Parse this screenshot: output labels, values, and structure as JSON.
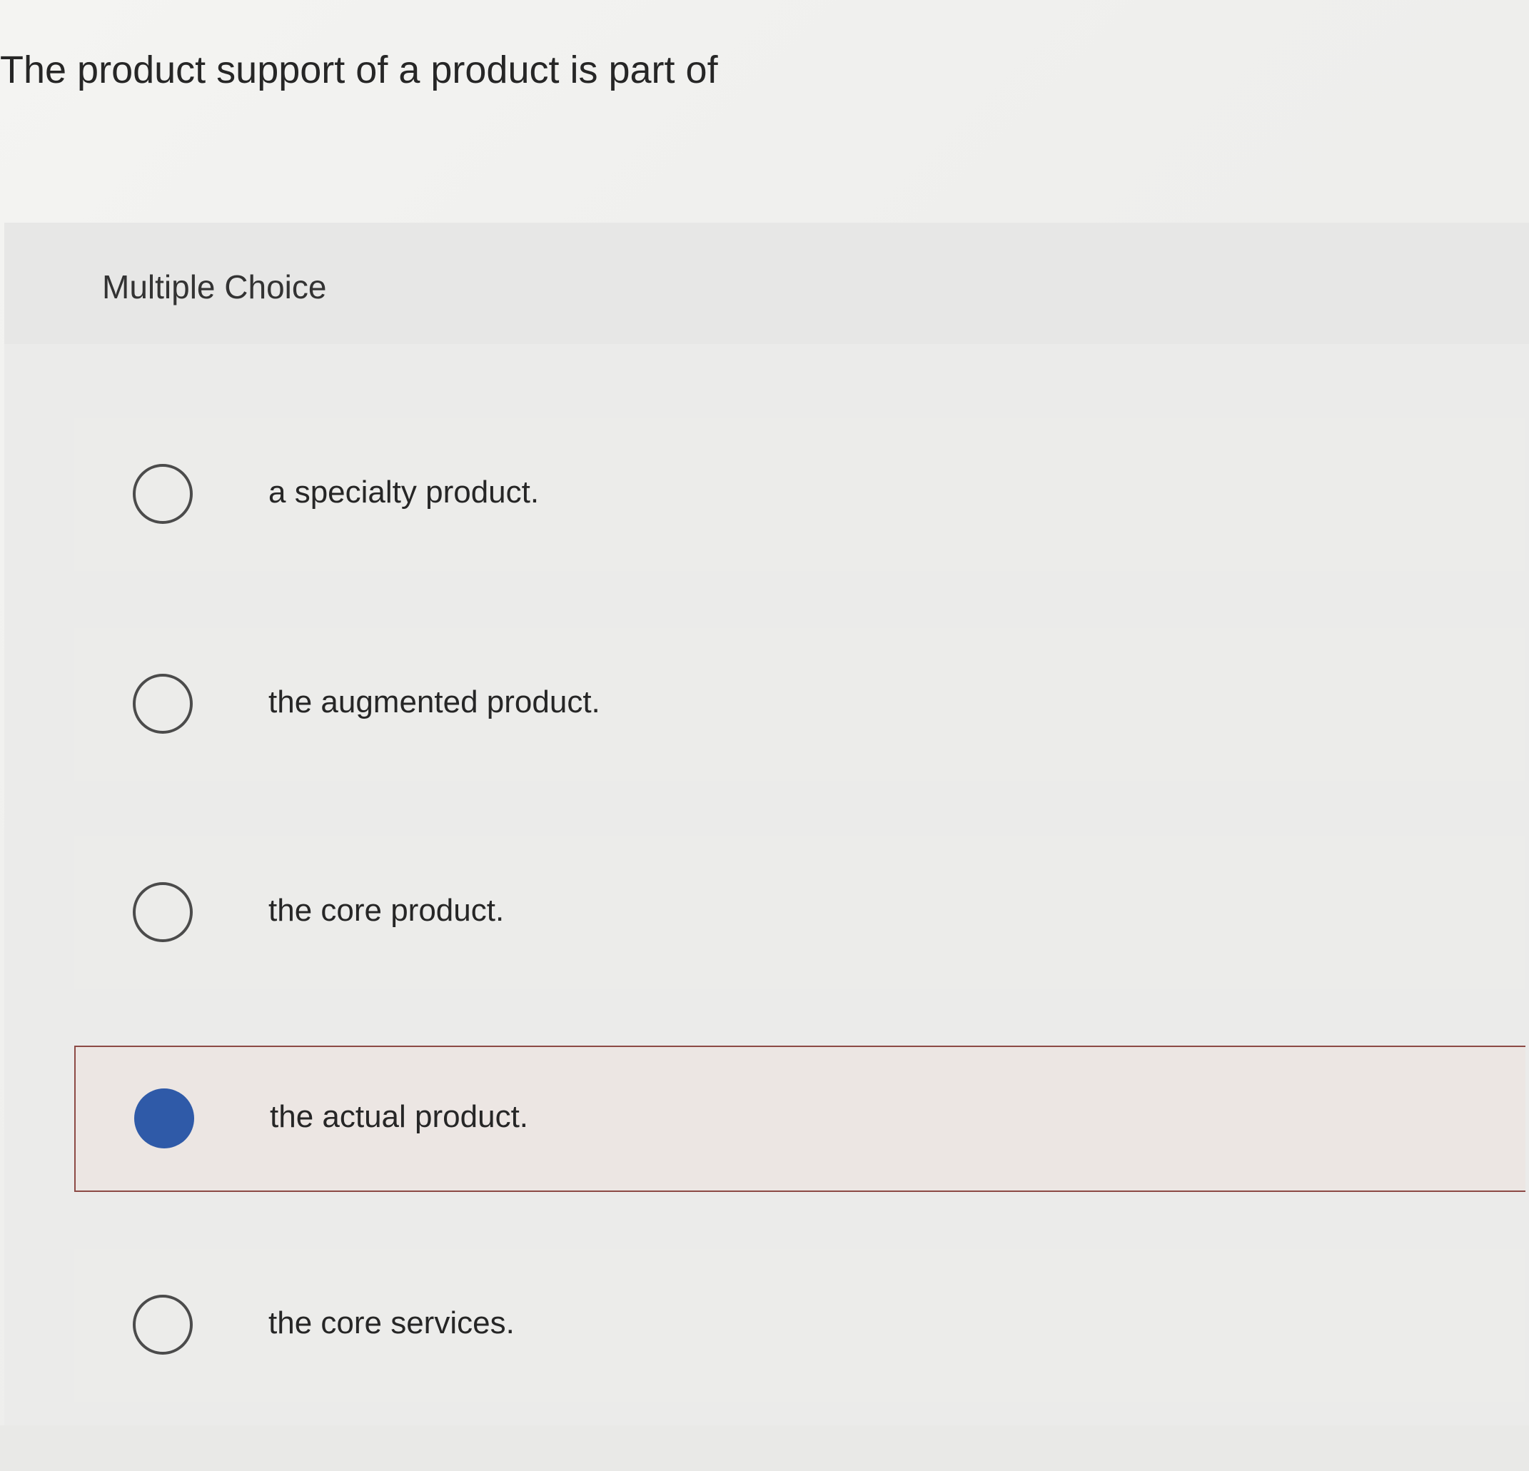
{
  "question": {
    "text": "The product support of a product is part of"
  },
  "card": {
    "type_label": "Multiple Choice"
  },
  "options": [
    {
      "label": "a specialty product.",
      "selected": false
    },
    {
      "label": "the augmented product.",
      "selected": false
    },
    {
      "label": "the core product.",
      "selected": false
    },
    {
      "label": "the actual product.",
      "selected": true
    },
    {
      "label": "the core services.",
      "selected": false
    }
  ],
  "colors": {
    "selected_radio": "#2f5aa8",
    "selected_border": "#8c4a45"
  }
}
